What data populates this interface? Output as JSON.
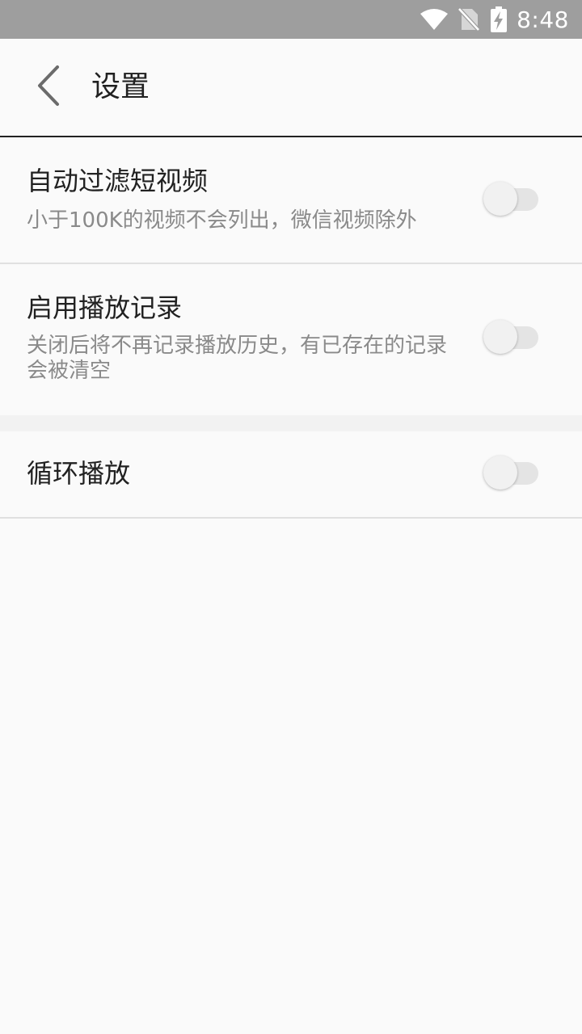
{
  "status_bar": {
    "time": "8:48",
    "icons": [
      "wifi-icon",
      "no-sim-icon",
      "battery-charging-icon"
    ]
  },
  "app_bar": {
    "back_icon": "chevron-left-icon",
    "title": "设置"
  },
  "settings": [
    {
      "title": "自动过滤短视频",
      "subtitle": "小于100K的视频不会列出，微信视频除外",
      "enabled": false
    },
    {
      "title": "启用播放记录",
      "subtitle": "关闭后将不再记录播放历史，有已存在的记录会被清空",
      "enabled": false
    },
    {
      "title": "循环播放",
      "enabled": false
    }
  ],
  "colors": {
    "status_bar": "#9e9e9e",
    "background": "#fafafa",
    "title_text": "#212121",
    "subtitle_text": "#8a8a8a",
    "switch_track_off": "#e4e4e4",
    "switch_thumb_off": "#f1f1f1"
  }
}
